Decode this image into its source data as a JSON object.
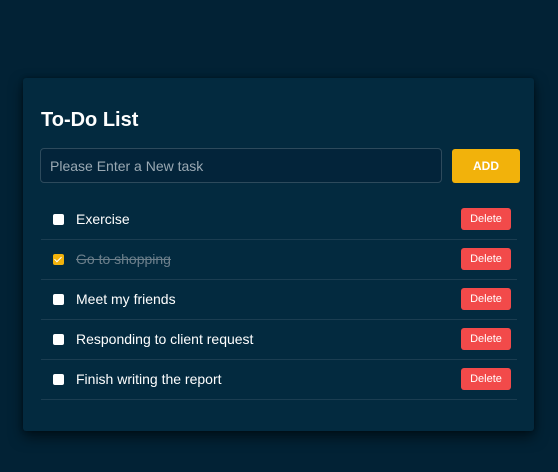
{
  "todo": {
    "title": "To-Do List",
    "input": {
      "value": "",
      "placeholder": "Please Enter a New task"
    },
    "add_label": "ADD",
    "delete_label": "Delete",
    "tasks": [
      {
        "text": "Exercise",
        "completed": false
      },
      {
        "text": "Go to shopping",
        "completed": true
      },
      {
        "text": "Meet my friends",
        "completed": false
      },
      {
        "text": "Responding to client request",
        "completed": false
      },
      {
        "text": "Finish writing the report",
        "completed": false
      }
    ]
  },
  "colors": {
    "page_background": "#022235",
    "card_background": "#032a3f",
    "accent": "#f2b20b",
    "delete": "#f24a4a",
    "completed_text": "#6c7f8b"
  }
}
